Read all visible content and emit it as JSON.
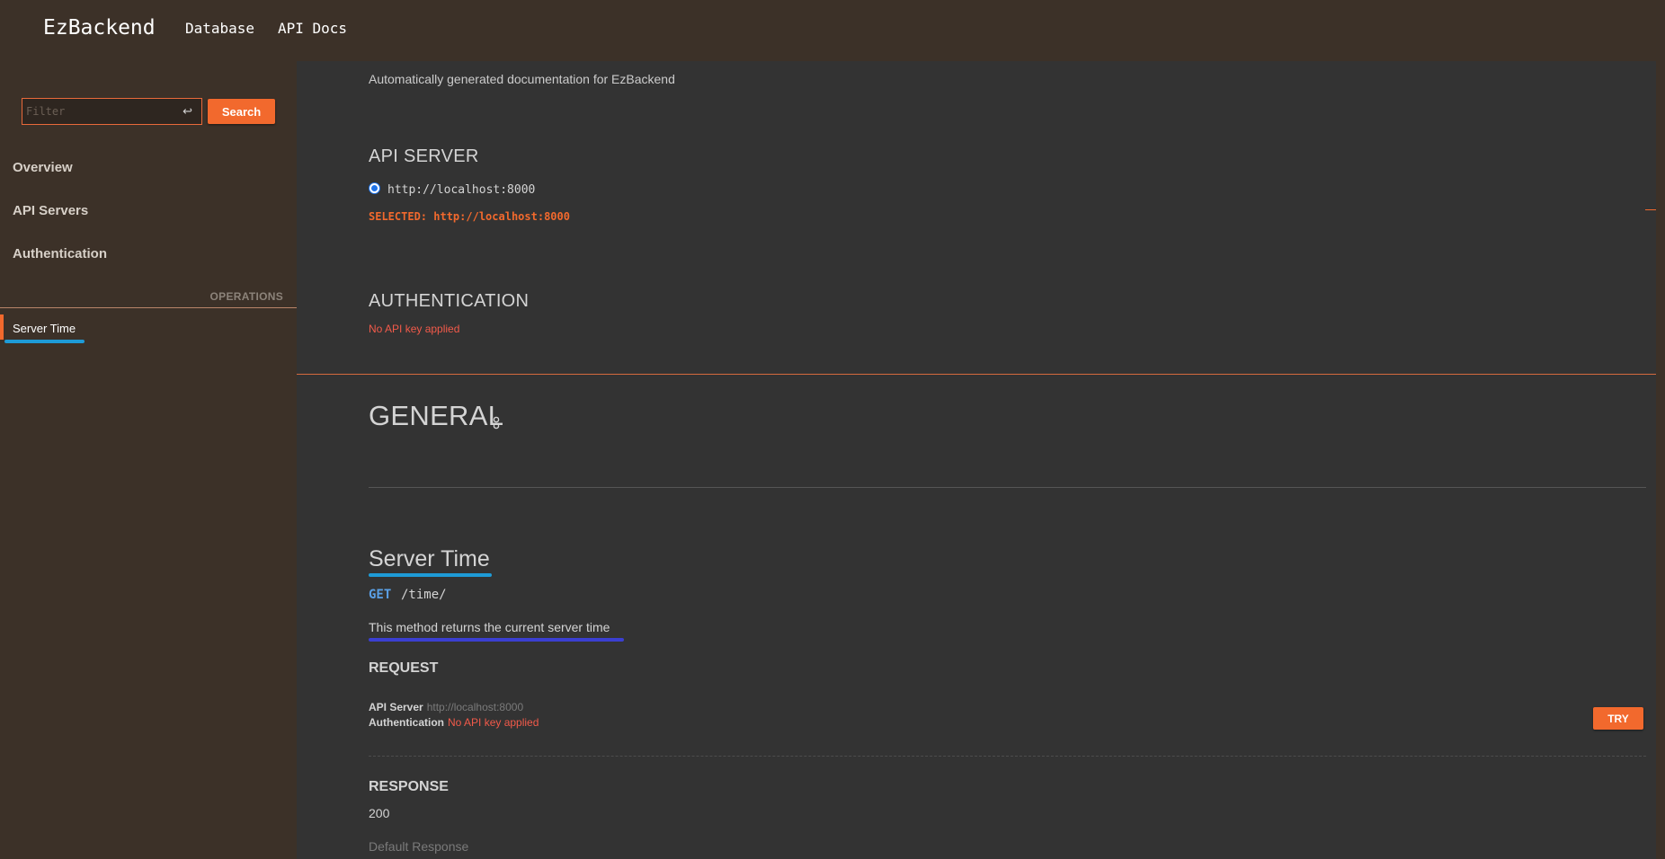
{
  "header": {
    "brand": "EzBackend",
    "nav": [
      "Database",
      "API Docs"
    ]
  },
  "sidebar": {
    "filter_placeholder": "Filter",
    "filter_value": "",
    "enter_glyph": "↩",
    "search_label": "Search",
    "items": [
      "Overview",
      "API Servers",
      "Authentication"
    ],
    "operations_label": "OPERATIONS",
    "operations": [
      "Server Time"
    ]
  },
  "main": {
    "intro": "Automatically generated documentation for EzBackend",
    "api_server": {
      "heading": "API SERVER",
      "url": "http://localhost:8000",
      "selected": "SELECTED: http://localhost:8000"
    },
    "authentication": {
      "heading": "AUTHENTICATION",
      "status": "No API key applied"
    },
    "general": {
      "heading": "GENERAL"
    },
    "operation": {
      "title": "Server Time",
      "method": "GET",
      "path": "/time/",
      "description": "This method returns the current server time",
      "request": {
        "heading": "REQUEST",
        "api_server_label": "API Server",
        "api_server_value": "http://localhost:8000",
        "auth_label": "Authentication",
        "auth_value": "No API key applied",
        "try_label": "TRY"
      },
      "response": {
        "heading": "RESPONSE",
        "code": "200",
        "description": "Default Response"
      }
    }
  },
  "colors": {
    "accent": "#f2692d",
    "sidebar_bg": "#3c3128",
    "main_bg": "#333333",
    "error": "#f25a4a",
    "method_get": "#5aa0e6",
    "annotation_underline": "#1e9bd7"
  },
  "icons": {
    "filter_enter": "enter-icon",
    "general_link": "link-icon"
  }
}
